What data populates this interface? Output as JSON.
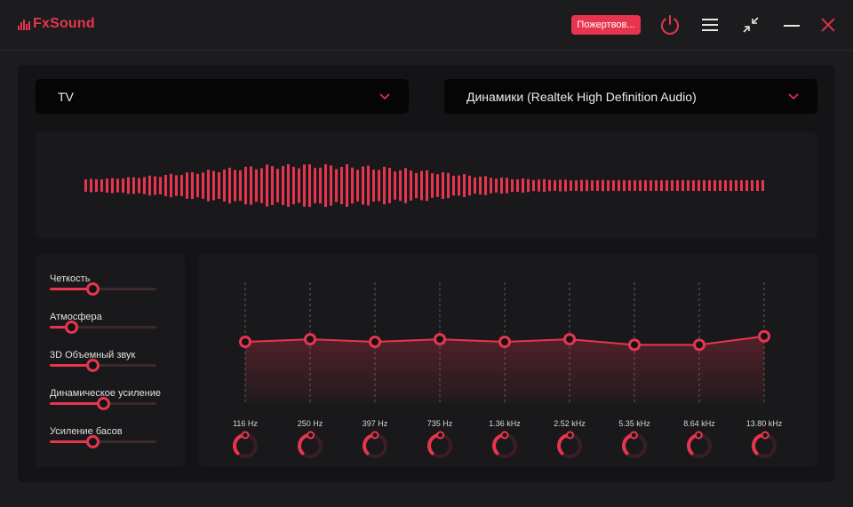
{
  "app": {
    "name": "FxSound"
  },
  "titlebar": {
    "donate_label": "Пожертвов...",
    "icons": [
      "power-icon",
      "menu-icon",
      "minimize-to-compact-icon",
      "minimize-icon",
      "close-icon"
    ]
  },
  "preset": {
    "value": "TV"
  },
  "output_device": {
    "value": "Динамики (Realtek High Definition Audio)"
  },
  "colors": {
    "accent": "#e8354f",
    "background": "#1c1c1e",
    "panel": "#141416",
    "card": "#19191b"
  },
  "effects": [
    {
      "label": "Четкость",
      "level": 0.4
    },
    {
      "label": "Атмосфера",
      "level": 0.2
    },
    {
      "label": "3D Объемный звук",
      "level": 0.4
    },
    {
      "label": "Динамическое усиление",
      "level": 0.5
    },
    {
      "label": "Усиление басов",
      "level": 0.4
    }
  ],
  "equalizer": {
    "bands": [
      {
        "freq": "116 Hz",
        "gain": 0.0
      },
      {
        "freq": "250 Hz",
        "gain": 0.7
      },
      {
        "freq": "397 Hz",
        "gain": 0.0
      },
      {
        "freq": "735 Hz",
        "gain": 0.7
      },
      {
        "freq": "1.36 kHz",
        "gain": 0.0
      },
      {
        "freq": "2.52 kHz",
        "gain": 0.7
      },
      {
        "freq": "5.35 kHz",
        "gain": -0.8
      },
      {
        "freq": "8.64 kHz",
        "gain": -0.8
      },
      {
        "freq": "13.80 kHz",
        "gain": 1.5
      }
    ],
    "gain_range": [
      -12,
      12
    ]
  }
}
